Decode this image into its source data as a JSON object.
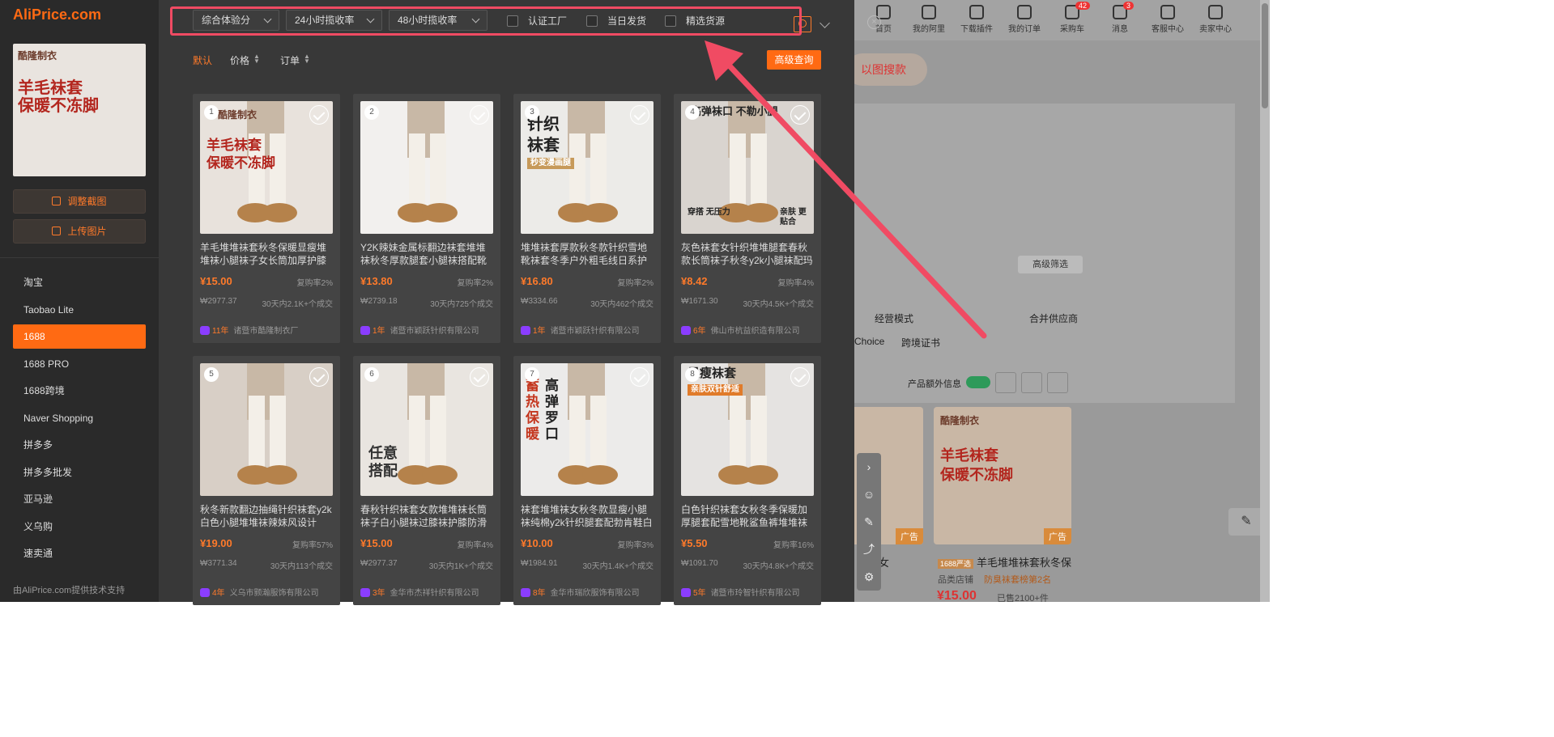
{
  "app": {
    "logo": "AliPrice.com"
  },
  "bg": {
    "nav": [
      {
        "label": "首页",
        "badge": ""
      },
      {
        "label": "我的阿里",
        "badge": ""
      },
      {
        "label": "下载插件",
        "badge": ""
      },
      {
        "label": "我的订单",
        "badge": ""
      },
      {
        "label": "采购车",
        "badge": "42"
      },
      {
        "label": "消息",
        "badge": "3"
      },
      {
        "label": "客服中心",
        "badge": ""
      },
      {
        "label": "卖家中心",
        "badge": ""
      }
    ],
    "image_search": "以图搜款",
    "advanced_filter": "高级筛选",
    "business_mode": "经营模式",
    "merge_supplier": "合并供应商",
    "choice": "Choice",
    "cross_border": "跨境证书",
    "extra_info": "产品额外信息",
    "ad_label": "广告",
    "product1_title": "袜子女",
    "product2_badge": "1688严选",
    "product2_title": "羊毛堆堆袜套秋冬保",
    "product2_store": "品类店铺",
    "product2_rank": "防臭袜套榜第2名",
    "product2_price": "¥15.00",
    "product2_sold": "已售2100+件",
    "product_img_brand": "酷隆制衣",
    "product_img_text1": "羊毛袜套",
    "product_img_text2": "保暖不冻脚"
  },
  "sidebar": {
    "preview": {
      "brand": "酷隆制衣",
      "line1": "羊毛袜套",
      "line2": "保暖不冻脚"
    },
    "adjust_crop": "调整截图",
    "upload_image": "上传图片",
    "platforms": [
      "淘宝",
      "Taobao Lite",
      "1688",
      "1688 PRO",
      "1688跨境",
      "Naver Shopping",
      "拼多多",
      "拼多多批发",
      "亚马逊",
      "义乌购",
      "速卖通"
    ],
    "active_platform": "1688",
    "footer": "由AliPrice.com提供技术支持"
  },
  "filters": {
    "select1": "综合体验分",
    "select2": "24小时揽收率",
    "select3": "48小时揽收率",
    "check1": "认证工厂",
    "check2": "当日发货",
    "check3": "精选货源"
  },
  "sort": {
    "default": "默认",
    "price": "价格",
    "orders": "订单",
    "advanced": "高级查询"
  },
  "products": [
    {
      "num": "1",
      "title": "羊毛堆堆袜套秋冬保暖显瘦堆堆袜小腿袜子女长筒加厚护膝中...",
      "price": "¥15.00",
      "repeat": "复购率2%",
      "gmv": "₩2977.37",
      "sold": "30天内2.1K+个成交",
      "years": "11年",
      "supplier": "诸暨市酷隆制衣厂",
      "img_color": "#e8e2dc",
      "overlay": [
        "酷隆制衣",
        "羊毛袜套",
        "保暖不冻脚"
      ]
    },
    {
      "num": "2",
      "title": "Y2K辣妹金属标翻边袜套堆堆袜秋冬厚款腿套小腿袜搭配靴子...",
      "price": "¥13.80",
      "repeat": "复购率2%",
      "gmv": "₩2739.18",
      "sold": "30天内725个成交",
      "years": "1年",
      "supplier": "诸暨市颖跃针织有限公司",
      "img_color": "#f2f0ee",
      "overlay": []
    },
    {
      "num": "3",
      "title": "堆堆袜套厚款秋冬款针织雪地靴袜套冬季户外粗毛线日系护腿...",
      "price": "¥16.80",
      "repeat": "复购率2%",
      "gmv": "₩3334.66",
      "sold": "30天内462个成交",
      "years": "1年",
      "supplier": "诸暨市颖跃针织有限公司",
      "img_color": "#ecebe8",
      "overlay": [
        "针织",
        "袜套",
        "秒变漫画腿"
      ]
    },
    {
      "num": "4",
      "title": "灰色袜套女针织堆堆腿套春秋款长筒袜子秋冬y2k小腿袜配玛丽...",
      "price": "¥8.42",
      "repeat": "复购率4%",
      "gmv": "₩1671.30",
      "sold": "30天内4.5K+个成交",
      "years": "6年",
      "supplier": "佛山市杭益织造有限公司",
      "img_color": "#d9d4cf",
      "overlay": [
        "高弹袜口 不勒小腿",
        "穿搭 无压力",
        "亲肤 更贴合"
      ]
    },
    {
      "num": "5",
      "title": "秋冬新款翻边抽绳针织袜套y2k白色小腿堆堆袜辣妹风设计感...",
      "price": "¥19.00",
      "repeat": "复购率57%",
      "gmv": "₩3771.34",
      "sold": "30天内113个成交",
      "years": "4年",
      "supplier": "义乌市颢瀚服饰有限公司",
      "img_color": "#d8cfc6",
      "overlay": []
    },
    {
      "num": "6",
      "title": "春秋针织袜套女款堆堆袜长筒袜子白小腿袜过膝袜护膝防滑秋...",
      "price": "¥15.00",
      "repeat": "复购率4%",
      "gmv": "₩2977.37",
      "sold": "30天内1K+个成交",
      "years": "3年",
      "supplier": "金华市杰祥针织有限公司",
      "img_color": "#e9e5e0",
      "overlay": [
        "任意",
        "搭配"
      ]
    },
    {
      "num": "7",
      "title": "袜套堆堆袜女秋冬款显瘦小腿袜纯棉y2k针织腿套配勃肯鞋白色...",
      "price": "¥10.00",
      "repeat": "复购率3%",
      "gmv": "₩1984.91",
      "sold": "30天内1.4K+个成交",
      "years": "8年",
      "supplier": "金华市瑞欣服饰有限公司",
      "img_color": "#ecebea",
      "overlay": [
        "蓄热保暖",
        "高弹罗口"
      ]
    },
    {
      "num": "8",
      "title": "白色针织袜套女秋冬季保暖加厚腿套配雪地靴鲨鱼裤堆堆袜小...",
      "price": "¥5.50",
      "repeat": "复购率16%",
      "gmv": "₩1091.70",
      "sold": "30天内4.8K+个成交",
      "years": "5年",
      "supplier": "诸暨市玲智针织有限公司",
      "img_color": "#e5e3e1",
      "overlay": [
        "显瘦袜套",
        "亲肤双针舒适"
      ]
    }
  ]
}
